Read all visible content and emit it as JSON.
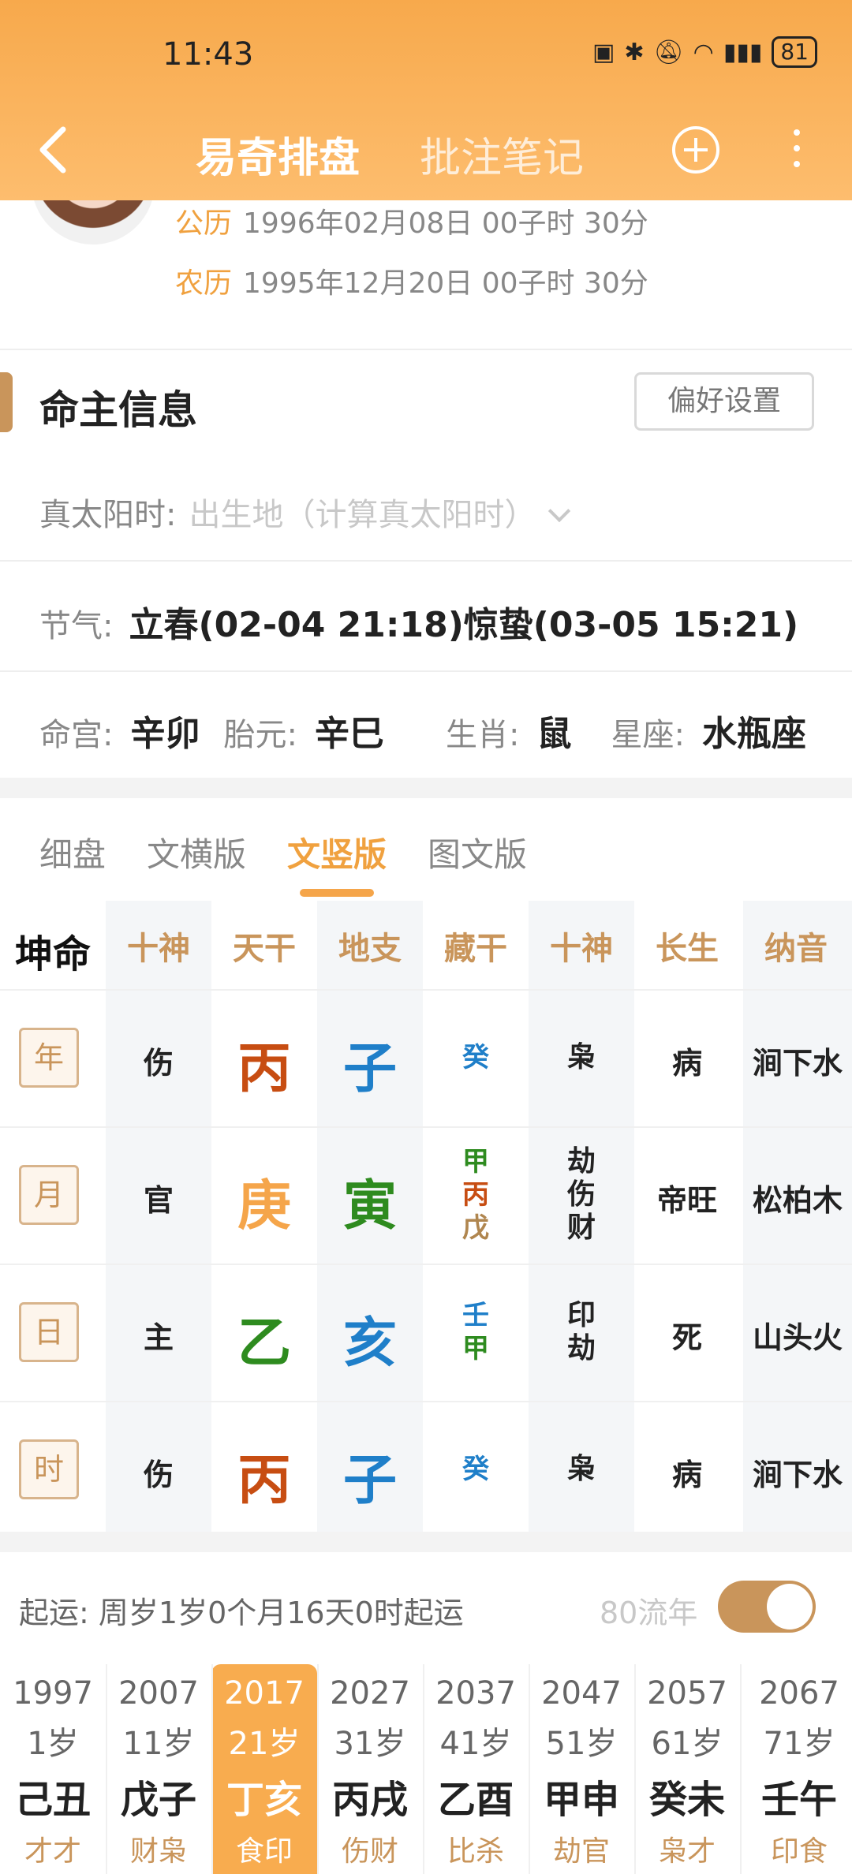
{
  "status": {
    "time": "11:43",
    "battery": "81"
  },
  "nav": {
    "title": "易奇排盘",
    "tab2": "批注笔记"
  },
  "profile": {
    "gregorian_label": "公历",
    "gregorian": "1996年02月08日 00子时 30分",
    "lunar_label": "农历",
    "lunar": "1995年12月20日 00子时 30分"
  },
  "section": {
    "title": "命主信息",
    "pref_button": "偏好设置"
  },
  "solar_time": {
    "label": "真太阳时:",
    "value": "出生地（计算真太阳时）"
  },
  "jieqi": {
    "label": "节气:",
    "value": "立春(02-04 21:18)惊蛰(03-05 15:21)"
  },
  "info": [
    {
      "k": "命宫:",
      "v": "辛卯"
    },
    {
      "k": "胎元:",
      "v": "辛巳"
    },
    {
      "k": "生肖:",
      "v": "鼠"
    },
    {
      "k": "星座:",
      "v": "水瓶座"
    }
  ],
  "tabs": [
    "细盘",
    "文横版",
    "文竖版",
    "图文版"
  ],
  "table": {
    "corner": "坤命",
    "headers": [
      "十神",
      "天干",
      "地支",
      "藏干",
      "十神",
      "长生",
      "纳音"
    ],
    "rows": [
      {
        "pillar": "年",
        "god": "伤",
        "stem": "丙",
        "stem_color": "#c74d12",
        "branch": "子",
        "branch_color": "#1f7fc9",
        "hidden": [
          {
            "t": "癸",
            "c": "#1f7fc9"
          }
        ],
        "hidden_gods": [
          "枭"
        ],
        "stage": "病",
        "nayin": "涧下水"
      },
      {
        "pillar": "月",
        "god": "官",
        "stem": "庚",
        "stem_color": "#f5a54a",
        "branch": "寅",
        "branch_color": "#2e8b1f",
        "hidden": [
          {
            "t": "甲",
            "c": "#2e8b1f"
          },
          {
            "t": "丙",
            "c": "#c74d12"
          },
          {
            "t": "戊",
            "c": "#b0864f"
          }
        ],
        "hidden_gods": [
          "劫",
          "伤",
          "财"
        ],
        "stage": "帝旺",
        "nayin": "松柏木"
      },
      {
        "pillar": "日",
        "god": "主",
        "stem": "乙",
        "stem_color": "#2e8b1f",
        "branch": "亥",
        "branch_color": "#1f7fc9",
        "hidden": [
          {
            "t": "壬",
            "c": "#1f7fc9"
          },
          {
            "t": "甲",
            "c": "#2e8b1f"
          }
        ],
        "hidden_gods": [
          "印",
          "劫"
        ],
        "stage": "死",
        "nayin": "山头火"
      },
      {
        "pillar": "时",
        "god": "伤",
        "stem": "丙",
        "stem_color": "#c74d12",
        "branch": "子",
        "branch_color": "#1f7fc9",
        "hidden": [
          {
            "t": "癸",
            "c": "#1f7fc9"
          }
        ],
        "hidden_gods": [
          "枭"
        ],
        "stage": "病",
        "nayin": "涧下水"
      }
    ]
  },
  "qiyun": {
    "label": "起运:",
    "value": "周岁1岁0个月16天0时起运",
    "flow_label": "80流年",
    "toggle_on": true
  },
  "luck": {
    "active_index": 2,
    "items": [
      {
        "year": "1997",
        "age": "1岁",
        "gz": "己丑",
        "gods": "才才"
      },
      {
        "year": "2007",
        "age": "11岁",
        "gz": "戊子",
        "gods": "财枭"
      },
      {
        "year": "2017",
        "age": "21岁",
        "gz": "丁亥",
        "gods": "食印"
      },
      {
        "year": "2027",
        "age": "31岁",
        "gz": "丙戌",
        "gods": "伤财"
      },
      {
        "year": "2037",
        "age": "41岁",
        "gz": "乙酉",
        "gods": "比杀"
      },
      {
        "year": "2047",
        "age": "51岁",
        "gz": "甲申",
        "gods": "劫官"
      },
      {
        "year": "2057",
        "age": "61岁",
        "gz": "癸未",
        "gods": "枭才"
      },
      {
        "year": "2067",
        "age": "71岁",
        "gz": "壬午",
        "gods": "印食"
      }
    ]
  },
  "colors": {
    "accent": "#f0a13f",
    "brand_brown": "#c9955b"
  }
}
